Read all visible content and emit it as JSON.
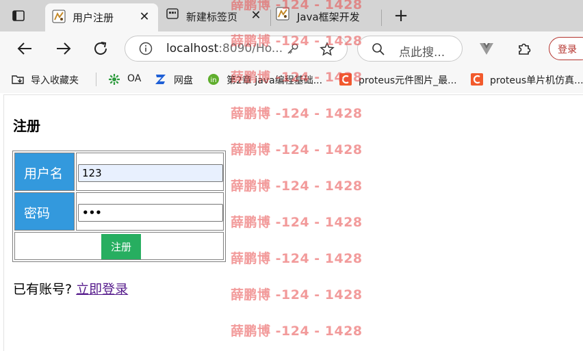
{
  "browser": {
    "tabs": [
      {
        "title": "用户注册",
        "active": true
      },
      {
        "title": "新建标签页",
        "active": false
      },
      {
        "title": "Java框架开发",
        "active": false
      }
    ],
    "address": {
      "host": "localhost",
      "rest": ":8090/Ho..."
    },
    "search_placeholder": "点此搜...",
    "login_label": "登录",
    "bookmarks": [
      {
        "label": "导入收藏夹",
        "icon": "import-folder-icon"
      },
      {
        "label": "OA",
        "icon": "oa-logo-icon"
      },
      {
        "label": "网盘",
        "icon": "cloud-drive-icon"
      },
      {
        "label": "第2章 java编程基础...",
        "icon": "site-favicon"
      },
      {
        "label": "proteus元件图片_最...",
        "icon": "csdn-icon"
      },
      {
        "label": "proteus单片机仿真...",
        "icon": "csdn-icon"
      }
    ]
  },
  "page": {
    "title": "注册",
    "form": {
      "username_label": "用户名",
      "username_value": "123",
      "password_label": "密码",
      "password_value": "•••",
      "submit_label": "注册"
    },
    "footer": {
      "prompt": "已有账号?",
      "login_link": "立即登录"
    }
  },
  "watermark": {
    "text": "薛鹏博 -124 - 1428",
    "color": "#e84848"
  },
  "colors": {
    "label_cell": "#3399dd",
    "submit_button": "#27ae60",
    "link_visited": "#551a8b"
  }
}
